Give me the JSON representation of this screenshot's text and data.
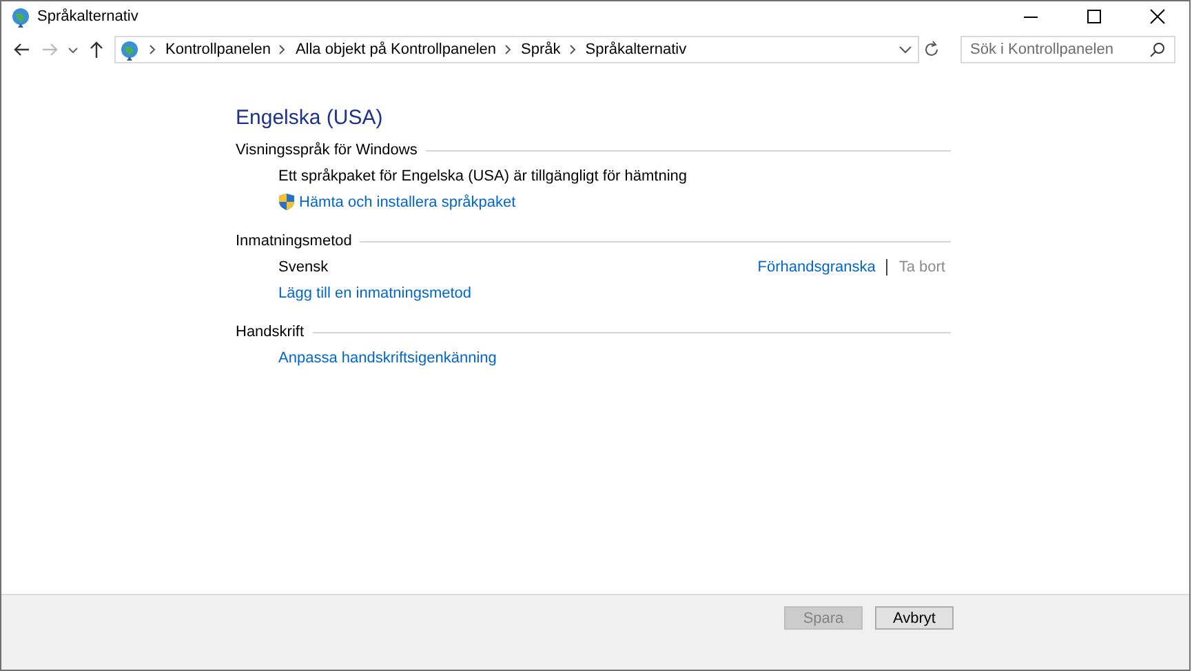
{
  "window": {
    "title": "Språkalternativ"
  },
  "nav": {
    "forward_disabled": true
  },
  "breadcrumb": [
    "Kontrollpanelen",
    "Alla objekt på Kontrollpanelen",
    "Språk",
    "Språkalternativ"
  ],
  "search": {
    "placeholder": "Sök i Kontrollpanelen"
  },
  "heading": "Engelska (USA)",
  "sections": [
    {
      "title": "Visningsspråk för Windows",
      "items": [
        {
          "kind": "text",
          "text": "Ett språkpaket för Engelska (USA) är tillgängligt för hämtning"
        },
        {
          "kind": "shield-link",
          "text": "Hämta och installera språkpaket"
        }
      ]
    },
    {
      "title": "Inmatningsmetod",
      "items": [
        {
          "kind": "method",
          "text": "Svensk",
          "actions": [
            {
              "label": "Förhandsgranska",
              "disabled": false
            },
            {
              "label": "Ta bort",
              "disabled": true
            }
          ]
        },
        {
          "kind": "link",
          "text": "Lägg till en inmatningsmetod"
        }
      ]
    },
    {
      "title": "Handskrift",
      "items": [
        {
          "kind": "link",
          "text": "Anpassa handskriftsigenkänning"
        }
      ]
    }
  ],
  "buttons": [
    {
      "label": "Spara",
      "disabled": true
    },
    {
      "label": "Avbryt",
      "disabled": false
    }
  ]
}
